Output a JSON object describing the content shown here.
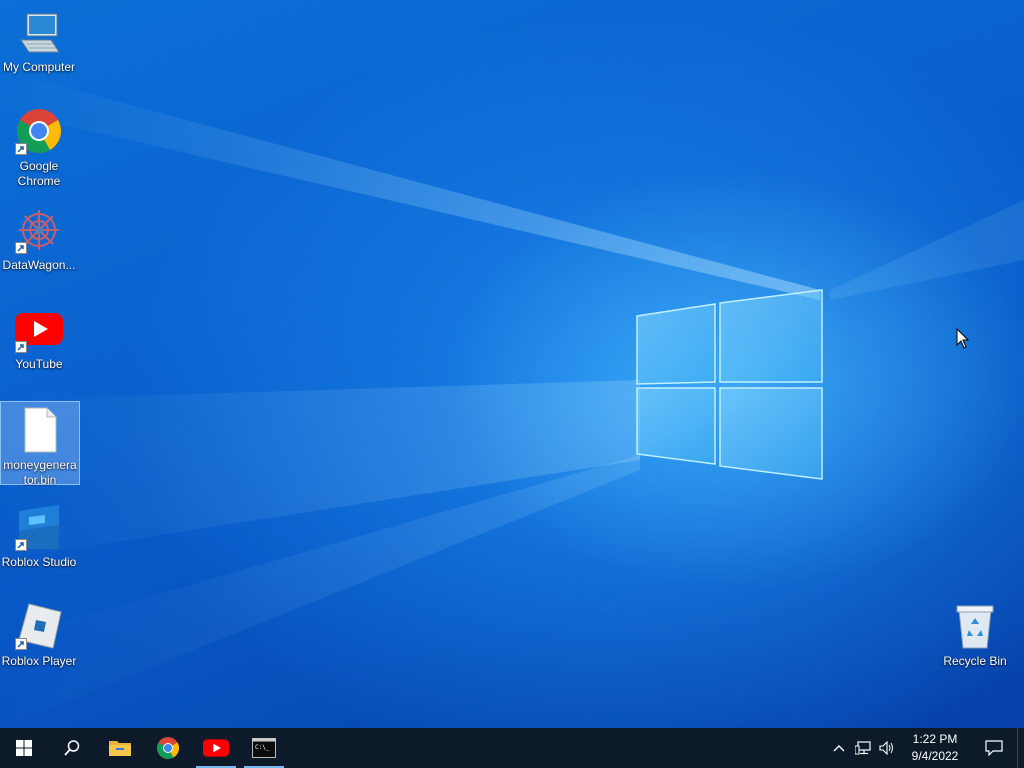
{
  "desktop": {
    "icons": [
      {
        "label": "My Computer"
      },
      {
        "label": "Google Chrome"
      },
      {
        "label": "DataWagon..."
      },
      {
        "label": "YouTube"
      },
      {
        "label": "moneygenerator.bin"
      },
      {
        "label": "Roblox Studio"
      },
      {
        "label": "Roblox Player"
      },
      {
        "label": "Recycle Bin"
      }
    ]
  },
  "taskbar": {
    "start_icon": "windows-start-icon",
    "search_icon": "search-icon",
    "pinned": [
      "file-explorer-icon",
      "chrome-icon",
      "youtube-icon",
      "terminal-icon"
    ],
    "tray": {
      "icons": [
        "chevron-up-icon",
        "network-icon",
        "volume-icon"
      ],
      "time": "1:22 PM",
      "date": "9/4/2022"
    },
    "notification_icon": "action-center-icon"
  },
  "colors": {
    "wallpaper": "#0b63cf",
    "taskbar": "#0d1a2a",
    "accent": "#76b9ed"
  }
}
